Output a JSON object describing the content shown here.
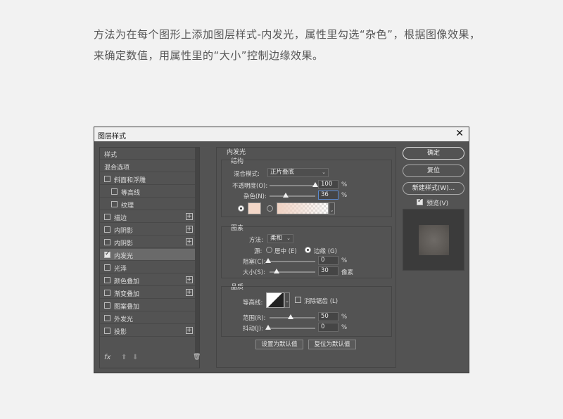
{
  "caption": "方法为在每个图形上添加图层样式-内发光，属性里勾选“杂色”，根据图像效果，来确定数值，用属性里的“大小”控制边缘效果。",
  "dialog": {
    "title": "图层样式",
    "close": "✕"
  },
  "stylelist": {
    "items": [
      {
        "label": "样式"
      },
      {
        "label": "混合选项"
      },
      {
        "label": "斜面和浮雕"
      },
      {
        "label": "等高线"
      },
      {
        "label": "纹理"
      },
      {
        "label": "描边"
      },
      {
        "label": "内阴影"
      },
      {
        "label": "内阴影"
      },
      {
        "label": "内发光"
      },
      {
        "label": "光泽"
      },
      {
        "label": "颜色叠加"
      },
      {
        "label": "渐变叠加"
      },
      {
        "label": "图案叠加"
      },
      {
        "label": "外发光"
      },
      {
        "label": "投影"
      }
    ],
    "plus": "+",
    "fx": "fx",
    "up": "⬆",
    "down": "⬇",
    "trash": "🗑"
  },
  "panel": {
    "title": "内发光",
    "structure": {
      "title": "结构",
      "blend_label": "混合模式:",
      "blend_value": "正片叠底",
      "opacity_label": "不透明度(O):",
      "opacity_value": "100",
      "noise_label": "杂色(N):",
      "noise_value": "36",
      "percent": "%"
    },
    "elements": {
      "title": "图素",
      "method_label": "方法:",
      "method_value": "柔和",
      "source_label": "源:",
      "center_label": "居中 (E)",
      "edge_label": "边缘 (G)",
      "choke_label": "阻塞(C):",
      "choke_value": "0",
      "size_label": "大小(S):",
      "size_value": "30",
      "px": "像素"
    },
    "quality": {
      "title": "品质",
      "contour_label": "等高线:",
      "antialias_label": "消除锯齿 (L)",
      "range_label": "范围(R):",
      "range_value": "50",
      "jitter_label": "抖动(J):",
      "jitter_value": "0"
    },
    "make_default": "设置为默认值",
    "reset_default": "复位为默认值"
  },
  "right": {
    "ok": "确定",
    "reset": "复位",
    "new_style": "新建样式(W)...",
    "preview": "预览(V)"
  }
}
